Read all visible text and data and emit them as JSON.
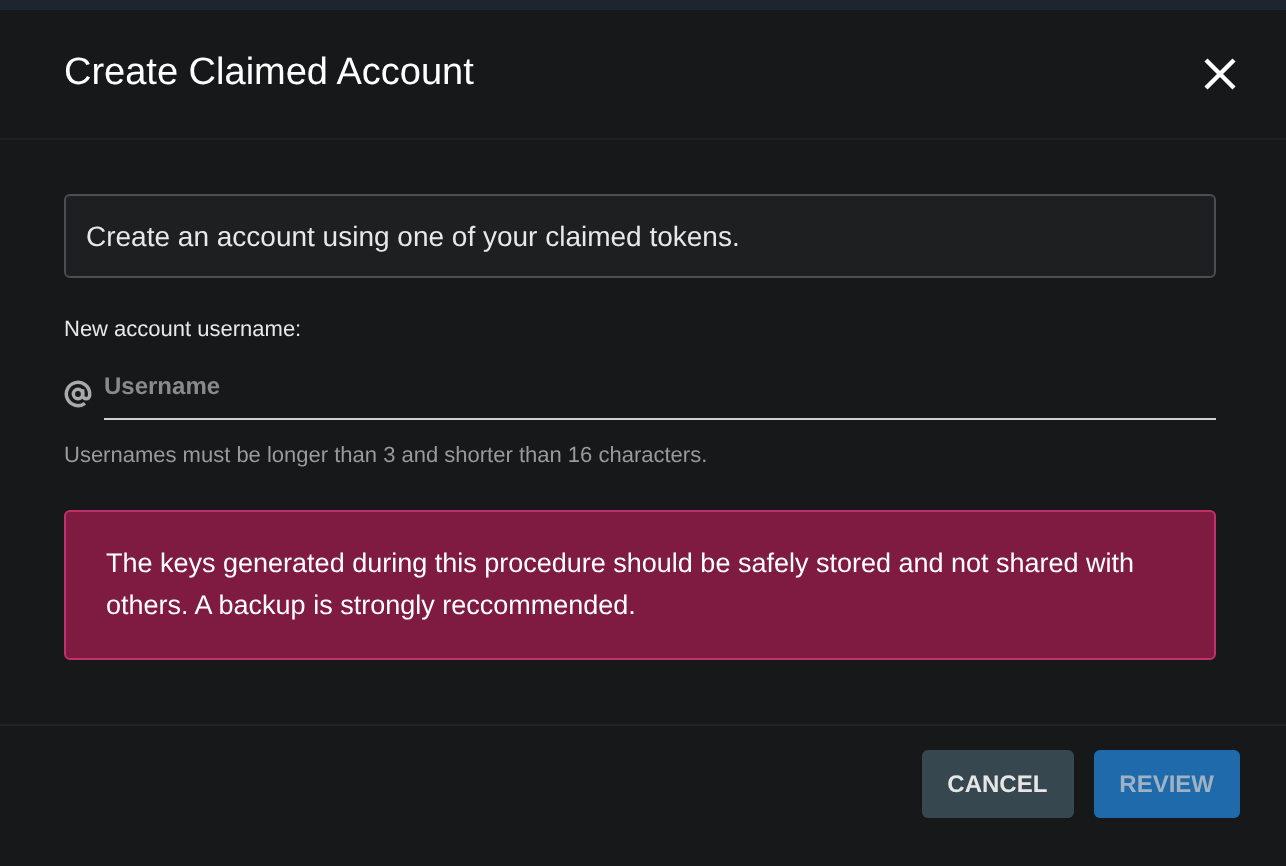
{
  "dialog": {
    "title": "Create Claimed Account"
  },
  "info": "Create an account using one of your claimed tokens.",
  "username_field": {
    "label": "New account username:",
    "placeholder": "Username",
    "helper": "Usernames must be longer than 3 and shorter than 16 characters."
  },
  "alert": "The keys generated during this procedure should be safely stored and not shared with others. A backup is strongly reccommended.",
  "buttons": [
    {
      "label": "CANCEL",
      "kind": "secondary",
      "disabled": false
    },
    {
      "label": "REVIEW",
      "kind": "primary",
      "disabled": true
    }
  ]
}
